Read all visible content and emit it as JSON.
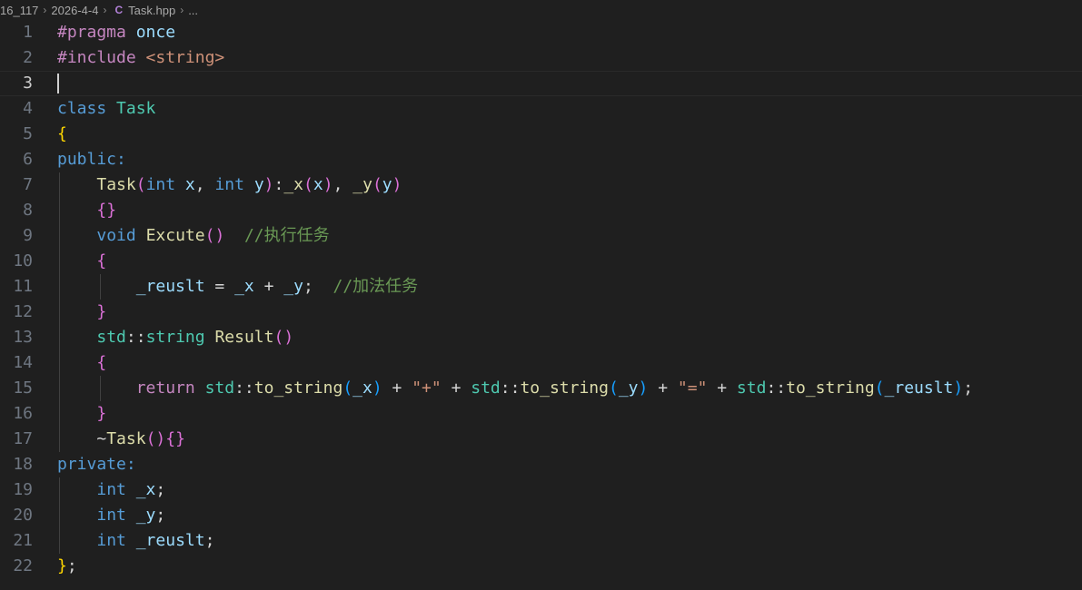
{
  "breadcrumb": {
    "items": [
      "16_117",
      "2026-4-4",
      "Task.hpp",
      "..."
    ],
    "separator": "›",
    "file_icon": "cpp-file-icon"
  },
  "editor": {
    "active_line": 3,
    "lines": [
      {
        "number": "1",
        "text": "#pragma once"
      },
      {
        "number": "2",
        "text": "#include <string>"
      },
      {
        "number": "3",
        "text": ""
      },
      {
        "number": "4",
        "text": "class Task"
      },
      {
        "number": "5",
        "text": "{"
      },
      {
        "number": "6",
        "text": "public:"
      },
      {
        "number": "7",
        "text": "    Task(int x, int y):_x(x), _y(y)"
      },
      {
        "number": "8",
        "text": "    {}"
      },
      {
        "number": "9",
        "text": "    void Excute()  //执行任务"
      },
      {
        "number": "10",
        "text": "    {"
      },
      {
        "number": "11",
        "text": "        _reuslt = _x + _y;  //加法任务"
      },
      {
        "number": "12",
        "text": "    }"
      },
      {
        "number": "13",
        "text": "    std::string Result()"
      },
      {
        "number": "14",
        "text": "    {"
      },
      {
        "number": "15",
        "text": "        return std::to_string(_x) + \"+\" + std::to_string(_y) + \"=\" + std::to_string(_reuslt);"
      },
      {
        "number": "16",
        "text": "    }"
      },
      {
        "number": "17",
        "text": "    ~Task(){}"
      },
      {
        "number": "18",
        "text": "private:"
      },
      {
        "number": "19",
        "text": "    int _x;"
      },
      {
        "number": "20",
        "text": "    int _y;"
      },
      {
        "number": "21",
        "text": "    int _reuslt;"
      },
      {
        "number": "22",
        "text": "};"
      }
    ]
  },
  "colors": {
    "background": "#1f1f1f",
    "keyword": "#569cd6",
    "type": "#4ec9b0",
    "function": "#dcdcaa",
    "variable": "#9cdcfe",
    "string": "#ce9178",
    "comment": "#6a9955",
    "preprocessor": "#c586c0"
  }
}
